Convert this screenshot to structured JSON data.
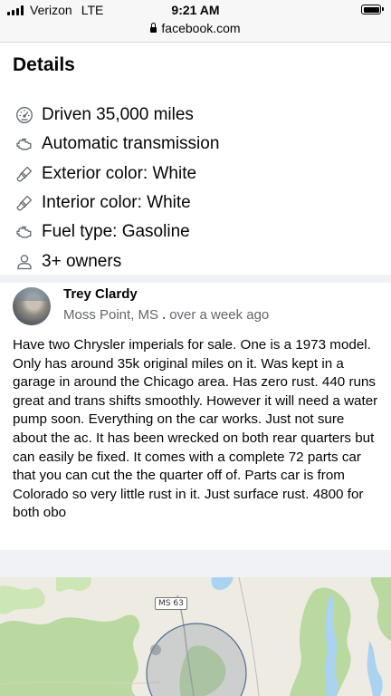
{
  "status_bar": {
    "carrier": "Verizon",
    "network": "LTE",
    "time": "9:21 AM"
  },
  "browser": {
    "url": "facebook.com"
  },
  "details": {
    "title": "Details",
    "items": [
      {
        "icon": "odometer-icon",
        "text": "Driven 35,000 miles"
      },
      {
        "icon": "engine-icon",
        "text": "Automatic transmission"
      },
      {
        "icon": "paintbrush-icon",
        "text": "Exterior color: White"
      },
      {
        "icon": "paintbrush-icon",
        "text": "Interior color: White"
      },
      {
        "icon": "engine-icon",
        "text": "Fuel type: Gasoline"
      },
      {
        "icon": "person-icon",
        "text": "3+ owners"
      }
    ]
  },
  "seller": {
    "name": "Trey Clardy",
    "location": "Moss Point, MS",
    "separator": ".",
    "posted": "over a week ago"
  },
  "description": "Have two Chrysler imperials for sale. One is a 1973 model. Only has around 35k original miles on it. Was kept in a garage in around the Chicago area. Has zero rust. 440 runs great and trans shifts smoothly. However it will need a water pump soon. Everything on the car works.  Just not sure about the ac. It has been wrecked on both rear quarters but can easily be fixed. It comes with a complete 72 parts car that you can cut the the quarter off of. Parts car is from Colorado so very little rust in it. Just surface rust. 4800 for both obo",
  "map": {
    "route_label": "MS 63"
  },
  "colors": {
    "secondary_text": "#65676b",
    "divider": "#f0f2f5",
    "map_land": "#eeebe3",
    "map_green": "#b9d9a0",
    "map_water": "#aad3f1"
  }
}
